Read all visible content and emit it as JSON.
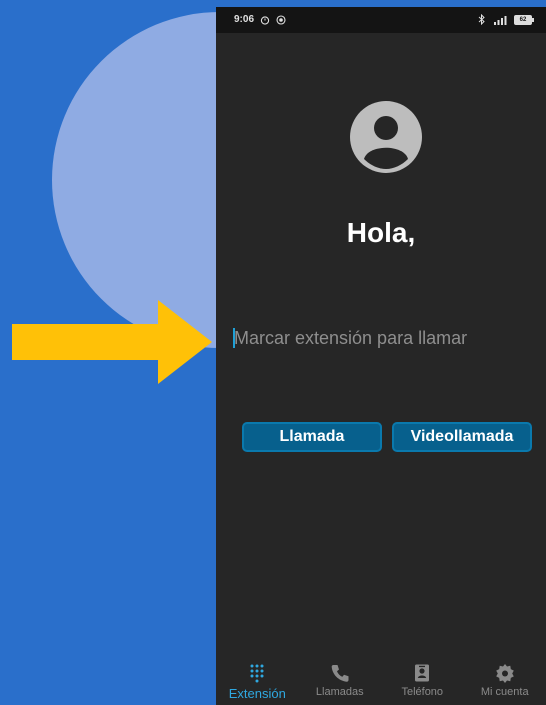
{
  "status_bar": {
    "time": "9:06",
    "battery": "62"
  },
  "main": {
    "greeting": "Hola,",
    "extension_placeholder": "Marcar extensión para llamar",
    "call_button": "Llamada",
    "video_call_button": "Videollamada"
  },
  "bottom_nav": {
    "items": [
      {
        "label": "Extensión",
        "icon": "dialpad-icon",
        "active": true
      },
      {
        "label": "Llamadas",
        "icon": "phone-icon",
        "active": false
      },
      {
        "label": "Teléfono",
        "icon": "contacts-icon",
        "active": false
      },
      {
        "label": "Mi cuenta",
        "icon": "gear-icon",
        "active": false
      }
    ]
  },
  "colors": {
    "background": "#2a6fcb",
    "circle": "#8fabe3",
    "arrow": "#ffc107",
    "app_background": "#262626",
    "button": "#07608d",
    "accent": "#2fa8e0"
  }
}
